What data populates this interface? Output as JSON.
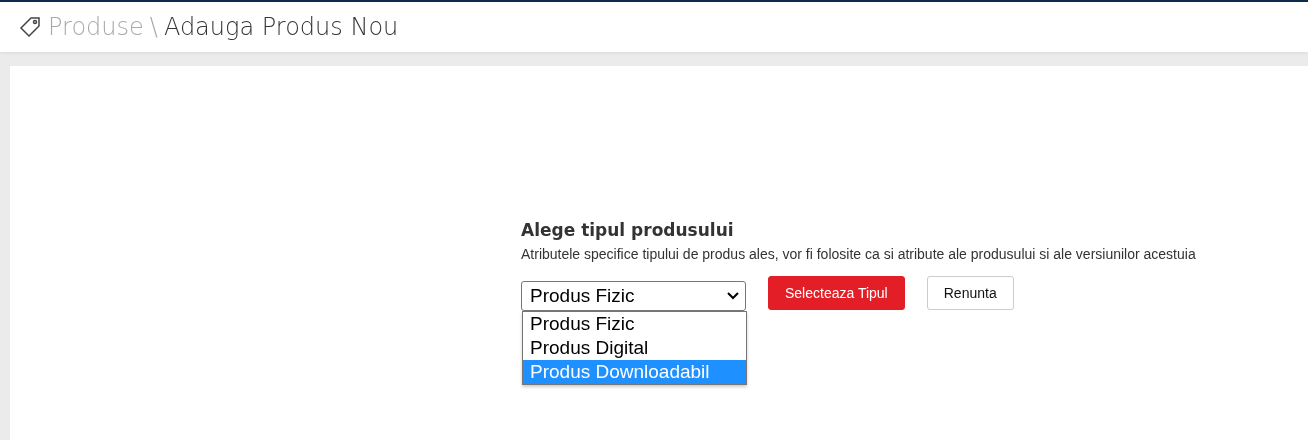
{
  "breadcrumb": {
    "parent": "Produse",
    "separator": "\\",
    "current": "Adauga Produs Nou"
  },
  "form": {
    "title": "Alege tipul produsului",
    "description": "Atributele specifice tipului de produs ales, vor fi folosite ca si atribute ale produsului si ale versiunilor acestuia",
    "select": {
      "value": "Produs Fizic",
      "expanded": true,
      "options": [
        {
          "label": "Produs Fizic",
          "highlighted": false
        },
        {
          "label": "Produs Digital",
          "highlighted": false
        },
        {
          "label": "Produs Downloadabil",
          "highlighted": true
        }
      ]
    },
    "buttons": [
      {
        "label": "Selecteaza Tipul",
        "kind": "primary"
      },
      {
        "label": "Renunta",
        "kind": "secondary"
      }
    ]
  }
}
